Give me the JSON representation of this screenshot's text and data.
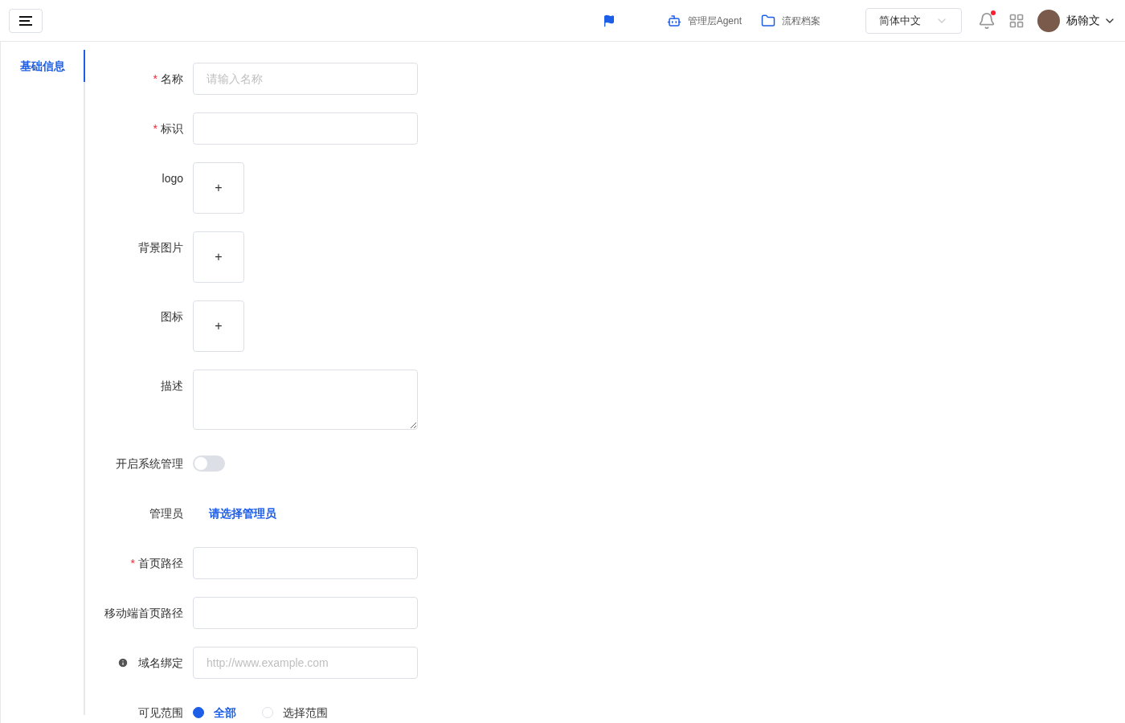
{
  "header": {
    "nav": [
      {
        "label": "管理层Agent"
      },
      {
        "label": "流程档案"
      }
    ],
    "language": "简体中文",
    "notification": {
      "unread": true
    },
    "user": "杨翰文"
  },
  "sidebar": {
    "items": [
      {
        "label": "基础信息",
        "selected": true
      }
    ]
  },
  "form": {
    "fields": [
      {
        "kind": "input",
        "label": "名称",
        "required_mark": "*",
        "placeholder": "请输入名称"
      },
      {
        "kind": "input",
        "label": "标识",
        "required_mark": "*"
      },
      {
        "kind": "upload",
        "label": "logo",
        "button": "+"
      },
      {
        "kind": "upload",
        "label": "背景图片",
        "button": "+"
      },
      {
        "kind": "upload",
        "label": "图标",
        "button": "+"
      },
      {
        "kind": "textarea",
        "label": "描述"
      },
      {
        "kind": "switch",
        "label": "开启系统管理",
        "on": false
      },
      {
        "kind": "link",
        "label": "管理员",
        "link": "请选择管理员"
      },
      {
        "kind": "input",
        "label": "首页路径",
        "required_mark": "*"
      },
      {
        "kind": "input",
        "label": "移动端首页路径"
      },
      {
        "kind": "input",
        "label": "域名绑定",
        "info": true,
        "placeholder": "http://www.example.com"
      },
      {
        "kind": "radio",
        "label": "可见范围",
        "options": [
          {
            "label": "全部",
            "selected": true
          },
          {
            "label": "选择范围",
            "selected": false
          }
        ]
      }
    ]
  }
}
